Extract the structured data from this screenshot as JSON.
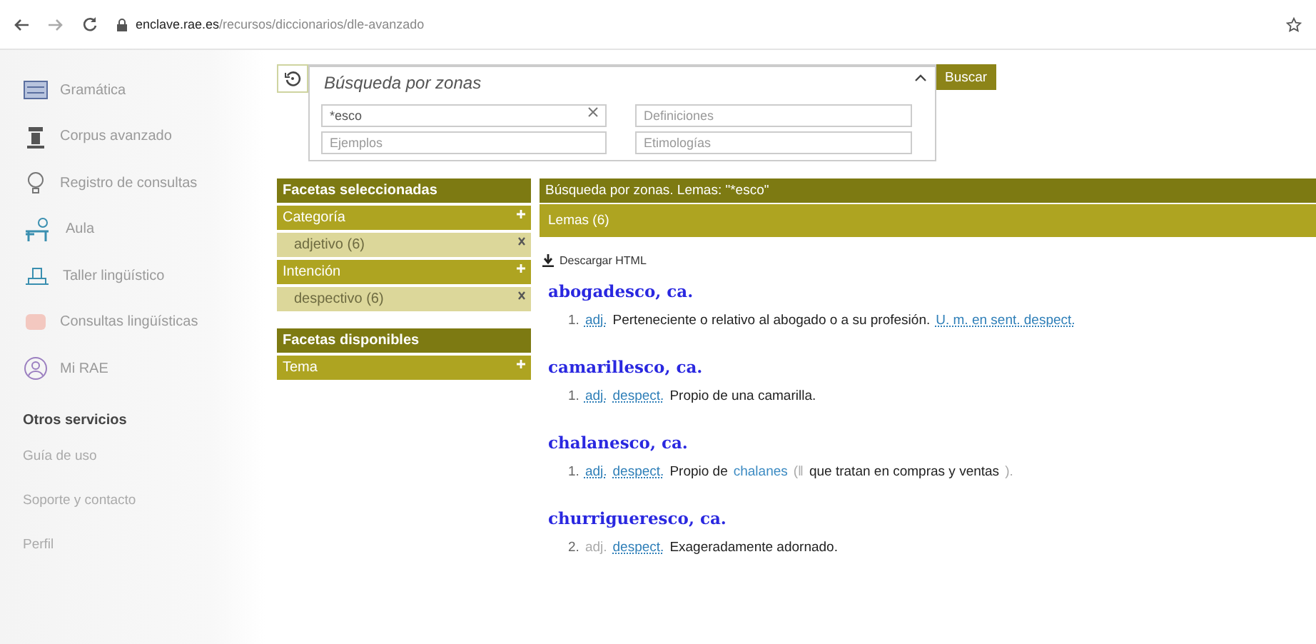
{
  "browser": {
    "url_host": "enclave.rae.es",
    "url_path": "/recursos/diccionarios/dle-avanzado"
  },
  "sidebar": {
    "items": [
      {
        "label": "Gramática"
      },
      {
        "label": "Corpus avanzado"
      },
      {
        "label": "Registro de consultas"
      },
      {
        "label": "Aula"
      },
      {
        "label": "Taller lingüístico"
      },
      {
        "label": "Consultas lingüísticas"
      },
      {
        "label": "Mi RAE"
      }
    ],
    "section_title": "Otros servicios",
    "links": [
      "Guía de uso",
      "Soporte y contacto",
      "Perfil"
    ]
  },
  "search": {
    "title": "Búsqueda por zonas",
    "fields": [
      {
        "value": "*esco",
        "clearable": true
      },
      {
        "placeholder": "Definiciones"
      },
      {
        "placeholder": "Ejemplos"
      },
      {
        "placeholder": "Etimologías"
      }
    ],
    "button": "Buscar",
    "expanded": true
  },
  "facets": {
    "selected_title": "Facetas seleccionadas",
    "selected": [
      {
        "name": "Categoría",
        "values": [
          "adjetivo (6)"
        ]
      },
      {
        "name": "Intención",
        "values": [
          "despectivo (6)"
        ]
      }
    ],
    "available_title": "Facetas disponibles",
    "available": [
      "Tema"
    ]
  },
  "results": {
    "title": "Búsqueda por zonas. Lemas: \"*esco\"",
    "subtitle": "Lemas (6)",
    "download": "Descargar HTML",
    "entries": [
      {
        "lemma": "abogadesco, ca.",
        "senses": [
          {
            "number": "1.",
            "parts": [
              {
                "kind": "abbr",
                "text": "adj."
              },
              {
                "kind": "text",
                "text": "Perteneciente o relativo al abogado o a su profesión."
              },
              {
                "kind": "abbr",
                "text": "U. m. en sent. despect."
              }
            ]
          }
        ]
      },
      {
        "lemma": "camarillesco, ca.",
        "senses": [
          {
            "number": "1.",
            "parts": [
              {
                "kind": "abbr",
                "text": "adj."
              },
              {
                "kind": "abbr",
                "text": "despect."
              },
              {
                "kind": "text",
                "text": "Propio de una camarilla."
              }
            ]
          }
        ]
      },
      {
        "lemma": "chalanesco, ca.",
        "senses": [
          {
            "number": "1.",
            "parts": [
              {
                "kind": "abbr",
                "text": "adj."
              },
              {
                "kind": "abbr",
                "text": "despect."
              },
              {
                "kind": "text",
                "text": "Propio de"
              },
              {
                "kind": "link",
                "text": "chalanes"
              },
              {
                "kind": "muted",
                "text": "(‖"
              },
              {
                "kind": "text",
                "text": "que tratan en compras y ventas"
              },
              {
                "kind": "muted",
                "text": ")."
              }
            ]
          }
        ]
      },
      {
        "lemma": "churrigueresco, ca.",
        "senses": [
          {
            "number": "2.",
            "parts": [
              {
                "kind": "muted",
                "text": "adj."
              },
              {
                "kind": "abbr",
                "text": "despect."
              },
              {
                "kind": "text",
                "text": "Exageradamente adornado."
              }
            ]
          }
        ]
      }
    ]
  }
}
